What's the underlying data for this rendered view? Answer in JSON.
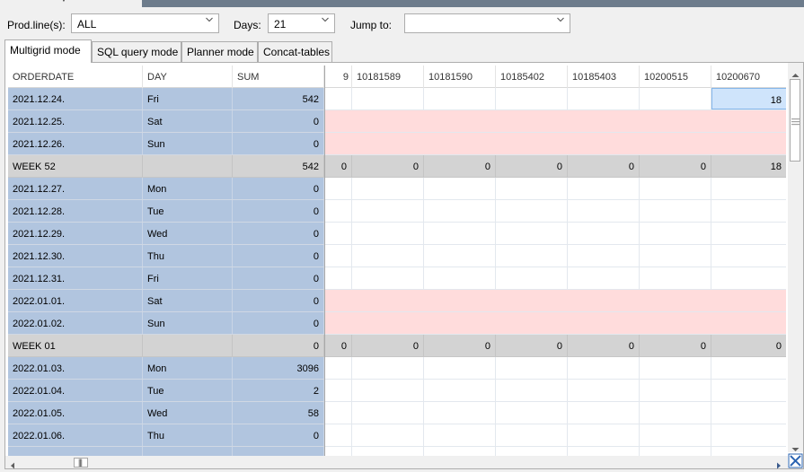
{
  "colors": {
    "frozen_bg": "#b1c5df",
    "week_bg": "#d3d3d3",
    "weekend_bg": "#ffdcdc",
    "selected_bg": "#cfe4fb",
    "titlebar_dark": "#6d7c8c"
  },
  "filters": {
    "prodline_label": "Prod.line(s):",
    "prodline_value": "ALL",
    "days_label": "Days:",
    "days_value": "21",
    "jump_label": "Jump to:",
    "jump_value": ""
  },
  "tabs": [
    "Multigrid mode",
    "SQL query mode",
    "Planner mode",
    "Concat-tables"
  ],
  "frozen_headers": [
    "ORDERDATE",
    "DAY",
    "SUM"
  ],
  "product_headers": [
    "9",
    "10181589",
    "10181590",
    "10185402",
    "10185403",
    "10200515",
    "10200670"
  ],
  "rows": [
    {
      "type": "day",
      "date": "2021.12.24.",
      "day": "Fri",
      "sum": "542",
      "values": [
        "",
        "",
        "",
        "",
        "",
        "",
        "18"
      ]
    },
    {
      "type": "weekend",
      "date": "2021.12.25.",
      "day": "Sat",
      "sum": "0",
      "values": [
        "",
        "",
        "",
        "",
        "",
        "",
        ""
      ]
    },
    {
      "type": "weekend",
      "date": "2021.12.26.",
      "day": "Sun",
      "sum": "0",
      "values": [
        "",
        "",
        "",
        "",
        "",
        "",
        ""
      ]
    },
    {
      "type": "week",
      "date": "WEEK 52",
      "day": "",
      "sum": "542",
      "values": [
        "0",
        "0",
        "0",
        "0",
        "0",
        "0",
        "18"
      ]
    },
    {
      "type": "day",
      "date": "2021.12.27.",
      "day": "Mon",
      "sum": "0",
      "values": [
        "",
        "",
        "",
        "",
        "",
        "",
        ""
      ]
    },
    {
      "type": "day",
      "date": "2021.12.28.",
      "day": "Tue",
      "sum": "0",
      "values": [
        "",
        "",
        "",
        "",
        "",
        "",
        ""
      ]
    },
    {
      "type": "day",
      "date": "2021.12.29.",
      "day": "Wed",
      "sum": "0",
      "values": [
        "",
        "",
        "",
        "",
        "",
        "",
        ""
      ]
    },
    {
      "type": "day",
      "date": "2021.12.30.",
      "day": "Thu",
      "sum": "0",
      "values": [
        "",
        "",
        "",
        "",
        "",
        "",
        ""
      ]
    },
    {
      "type": "day",
      "date": "2021.12.31.",
      "day": "Fri",
      "sum": "0",
      "values": [
        "",
        "",
        "",
        "",
        "",
        "",
        ""
      ]
    },
    {
      "type": "weekend",
      "date": "2022.01.01.",
      "day": "Sat",
      "sum": "0",
      "values": [
        "",
        "",
        "",
        "",
        "",
        "",
        ""
      ]
    },
    {
      "type": "weekend",
      "date": "2022.01.02.",
      "day": "Sun",
      "sum": "0",
      "values": [
        "",
        "",
        "",
        "",
        "",
        "",
        ""
      ]
    },
    {
      "type": "week",
      "date": "WEEK 01",
      "day": "",
      "sum": "0",
      "values": [
        "0",
        "0",
        "0",
        "0",
        "0",
        "0",
        "0"
      ]
    },
    {
      "type": "day",
      "date": "2022.01.03.",
      "day": "Mon",
      "sum": "3096",
      "values": [
        "",
        "",
        "",
        "",
        "",
        "",
        ""
      ]
    },
    {
      "type": "day",
      "date": "2022.01.04.",
      "day": "Tue",
      "sum": "2",
      "values": [
        "",
        "",
        "",
        "",
        "",
        "",
        ""
      ]
    },
    {
      "type": "day",
      "date": "2022.01.05.",
      "day": "Wed",
      "sum": "58",
      "values": [
        "",
        "",
        "",
        "",
        "",
        "",
        ""
      ]
    },
    {
      "type": "day",
      "date": "2022.01.06.",
      "day": "Thu",
      "sum": "0",
      "values": [
        "",
        "",
        "",
        "",
        "",
        "",
        ""
      ]
    },
    {
      "type": "day",
      "date": "",
      "day": "",
      "sum": "",
      "values": [
        "",
        "",
        "",
        "",
        "",
        "",
        ""
      ]
    }
  ]
}
